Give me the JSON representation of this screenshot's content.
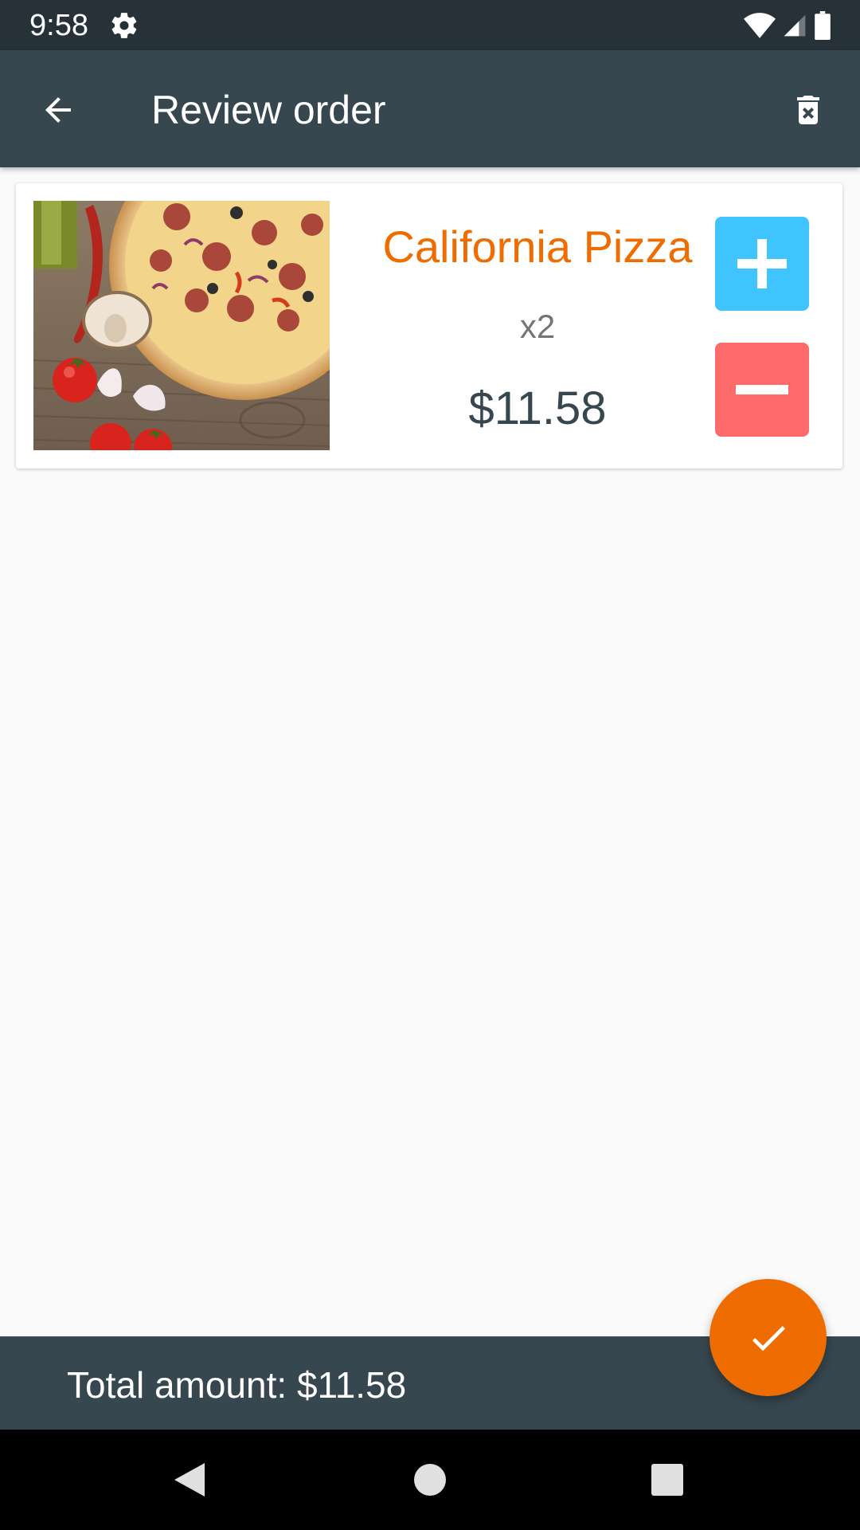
{
  "status_bar": {
    "time": "9:58",
    "icons": [
      "gear-icon",
      "wifi-icon",
      "cell-signal-icon",
      "battery-icon"
    ]
  },
  "app_bar": {
    "title": "Review order",
    "back_icon": "arrow-left-icon",
    "delete_icon": "delete-forever-icon"
  },
  "order": {
    "items": [
      {
        "name": "California Pizza",
        "quantity": "x2",
        "price": "$11.58",
        "image": "pizza-photo"
      }
    ]
  },
  "footer": {
    "total_label": "Total amount: $11.58",
    "fab_icon": "check-icon"
  },
  "navigation_bar": {
    "icons": [
      "nav-back-icon",
      "nav-home-icon",
      "nav-recents-icon"
    ]
  },
  "colors": {
    "status_bar": "#263238",
    "app_bar": "#37474f",
    "accent_orange": "#ef6c00",
    "plus_button": "#40c4ff",
    "minus_button": "#ff6b6b",
    "background": "#fafafa"
  }
}
